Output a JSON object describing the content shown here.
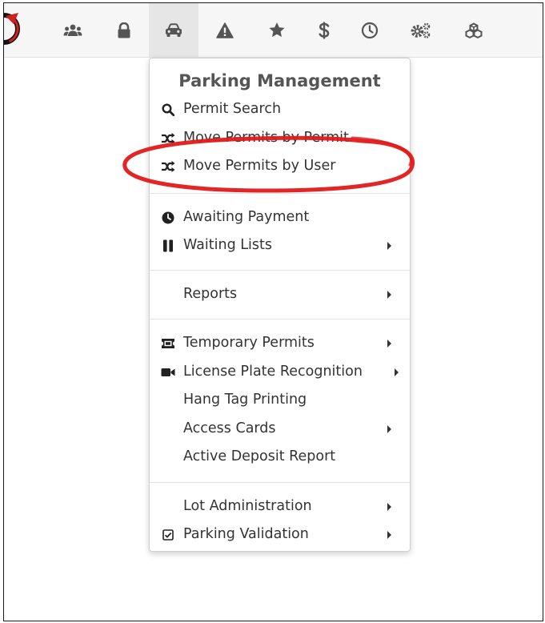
{
  "navbar": {
    "icons": [
      {
        "name": "users-icon"
      },
      {
        "name": "lock-icon"
      },
      {
        "name": "car-icon"
      },
      {
        "name": "warning-icon"
      },
      {
        "name": "star-icon"
      },
      {
        "name": "dollar-icon"
      },
      {
        "name": "clock-icon"
      },
      {
        "name": "gears-icon"
      },
      {
        "name": "cubes-icon"
      }
    ],
    "active_icon": "car-icon"
  },
  "menu": {
    "header": "Parking Management",
    "items": [
      {
        "label": "Permit Search",
        "icon": "search-icon"
      },
      {
        "label": "Move Permits by Permit",
        "icon": "shuffle-icon"
      },
      {
        "label": "Move Permits by User",
        "icon": "shuffle-icon"
      },
      {
        "label": "Awaiting Payment",
        "icon": "clock-icon"
      },
      {
        "label": "Waiting Lists",
        "icon": "pause-icon",
        "submenu": true
      },
      {
        "label": "Reports",
        "icon": "",
        "submenu": true
      },
      {
        "label": "Temporary Permits",
        "icon": "ticket-icon",
        "submenu": true
      },
      {
        "label": "License Plate Recognition",
        "icon": "video-camera-icon",
        "submenu": true
      },
      {
        "label": "Hang Tag Printing",
        "icon": ""
      },
      {
        "label": "Access Cards",
        "icon": "",
        "submenu": true
      },
      {
        "label": "Active Deposit Report",
        "icon": ""
      },
      {
        "label": "Lot Administration",
        "icon": "",
        "submenu": true
      },
      {
        "label": "Parking Validation",
        "icon": "checkbox-icon",
        "submenu": true
      }
    ]
  },
  "colors": {
    "navbar_bg": "#f6f6f6",
    "active_tab_bg": "#e6e6e6",
    "icon_color": "#555555",
    "annotation_red": "#e01a1a"
  }
}
